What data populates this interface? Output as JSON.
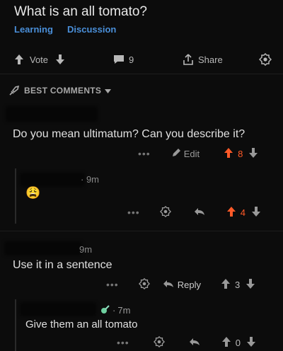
{
  "post": {
    "title": "What is an all tomato?",
    "flairs": [
      "Learning",
      "Discussion"
    ],
    "vote_label": "Vote",
    "comment_count": "9",
    "share_label": "Share"
  },
  "sort": {
    "label": "BEST COMMENTS"
  },
  "comments": [
    {
      "text": "Do you mean ultimatum? Can you describe it?",
      "action_label": "Edit",
      "score": "8"
    },
    {
      "time": "9m",
      "emoji": "😩",
      "score": "4"
    },
    {
      "time": "9m",
      "text": "Use it in a sentence",
      "action_label": "Reply",
      "score": "3"
    },
    {
      "time": "7m",
      "text": "Give them an all tomato",
      "score": "0"
    }
  ],
  "colors": {
    "upvoted": "#ff5a28",
    "flair": "#4a8fd9",
    "background": "#0c0c0c"
  }
}
